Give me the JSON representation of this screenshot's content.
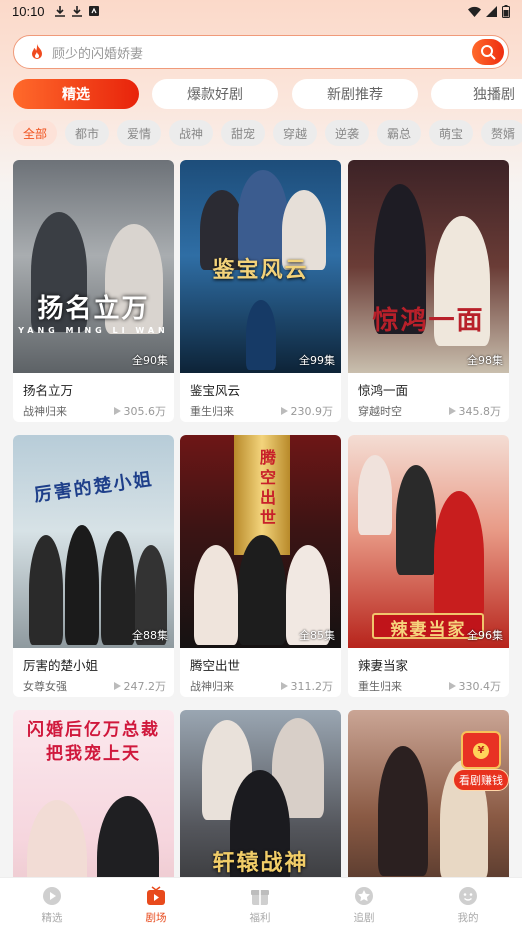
{
  "status_bar": {
    "time": "10:10"
  },
  "search": {
    "placeholder": "顾少的闪婚娇妻"
  },
  "tabs": [
    {
      "label": "精选",
      "active": true
    },
    {
      "label": "爆款好剧",
      "active": false
    },
    {
      "label": "新剧推荐",
      "active": false
    },
    {
      "label": "独播剧",
      "active": false
    }
  ],
  "categories": [
    "全部",
    "都市",
    "爱情",
    "战神",
    "甜宠",
    "穿越",
    "逆袭",
    "霸总",
    "萌宝",
    "赘婿"
  ],
  "dramas": [
    {
      "title": "扬名立万",
      "genre": "战神归来",
      "views": "305.6万",
      "episodes": "全90集",
      "poster_text": "扬名立万",
      "poster_sub": "YANG MING LI WAN"
    },
    {
      "title": "鉴宝风云",
      "genre": "重生归来",
      "views": "230.9万",
      "episodes": "全99集",
      "poster_text": "鉴宝风云"
    },
    {
      "title": "惊鸿一面",
      "genre": "穿越时空",
      "views": "345.8万",
      "episodes": "全98集",
      "poster_text": "惊鸿一面"
    },
    {
      "title": "厉害的楚小姐",
      "genre": "女尊女强",
      "views": "247.2万",
      "episodes": "全88集",
      "poster_text": "厉害的楚小姐"
    },
    {
      "title": "腾空出世",
      "genre": "战神归来",
      "views": "311.2万",
      "episodes": "全85集",
      "poster_text": "腾空出世"
    },
    {
      "title": "辣妻当家",
      "genre": "重生归来",
      "views": "330.4万",
      "episodes": "全96集",
      "poster_text": "辣妻当家"
    },
    {
      "poster_text": "闪婚后亿万总裁把我宠上天"
    },
    {
      "poster_text": "轩辕战神"
    },
    {
      "poster_text": ""
    }
  ],
  "reward": {
    "label": "看剧赚钱",
    "coin": "¥"
  },
  "bottom_nav": [
    {
      "label": "精选",
      "icon": "play-circle-icon"
    },
    {
      "label": "剧场",
      "icon": "tv-icon",
      "active": true
    },
    {
      "label": "福利",
      "icon": "gift-icon"
    },
    {
      "label": "追剧",
      "icon": "star-icon"
    },
    {
      "label": "我的",
      "icon": "smile-icon"
    }
  ],
  "colors": {
    "accent": "#ee3a12",
    "accent_light": "#fde2d8"
  }
}
